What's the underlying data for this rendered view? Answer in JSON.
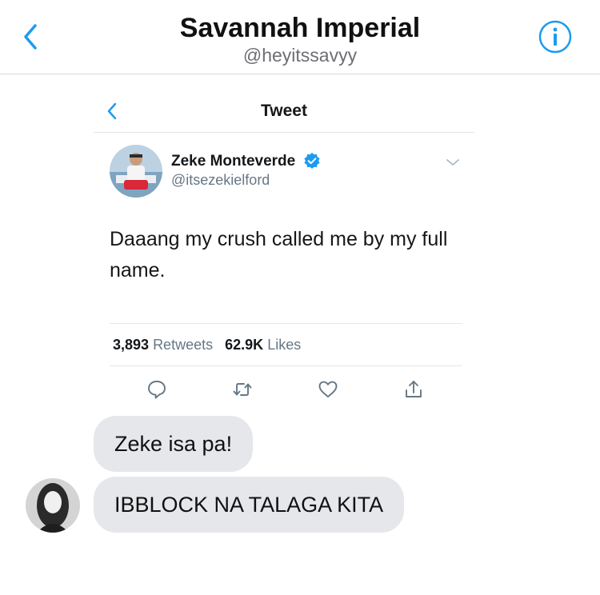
{
  "header": {
    "title": "Savannah Imperial",
    "handle": "@heyitssavyy",
    "back_icon": "chevron-left-icon",
    "info_icon": "info-circle-icon",
    "accent_color": "#1d9bf0"
  },
  "tweet": {
    "nav_title": "Tweet",
    "author_name": "Zeke Monteverde",
    "author_handle": "@itsezekielford",
    "verified": true,
    "text": "Daaang my crush called me by my full name.",
    "retweets_count": "3,893",
    "retweets_label": "Retweets",
    "likes_count": "62.9K",
    "likes_label": "Likes",
    "actions": [
      "reply-icon",
      "retweet-icon",
      "like-icon",
      "share-icon"
    ]
  },
  "messages": [
    {
      "text": "Zeke isa pa!"
    },
    {
      "text": "IBBLOCK NA TALAGA KITA"
    }
  ]
}
